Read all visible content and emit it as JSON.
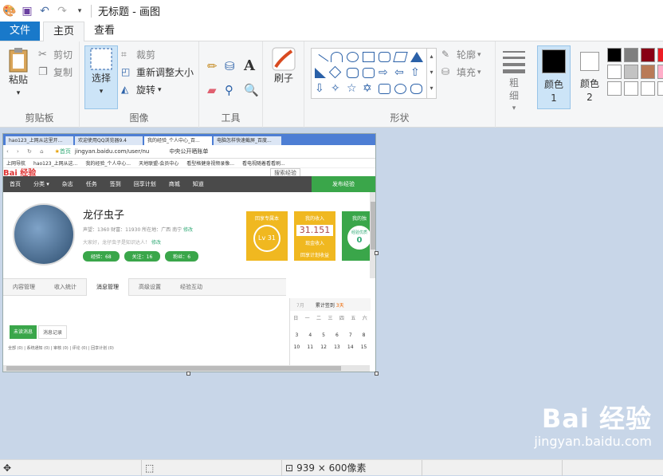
{
  "window": {
    "title": "无标题 - 画图"
  },
  "tabs": [
    {
      "label": "文件"
    },
    {
      "label": "主页"
    },
    {
      "label": "查看"
    }
  ],
  "clipboard": {
    "paste": "粘贴",
    "cut": "剪切",
    "copy": "复制",
    "group": "剪贴板"
  },
  "image": {
    "select": "选择",
    "crop": "裁剪",
    "resize": "重新调整大小",
    "rotate": "旋转",
    "group": "图像"
  },
  "tools": {
    "group": "工具"
  },
  "brushes": {
    "label": "刷子"
  },
  "shapes": {
    "outline": "轮廓",
    "fill": "填充",
    "group": "形状"
  },
  "size": {
    "label": "粗细"
  },
  "colors": {
    "color1": "颜色 1",
    "color2": "颜色 2",
    "palette": [
      "#000000",
      "#7f7f7f",
      "#880015",
      "#ed1c24",
      "#ffffff",
      "#c3c3c3",
      "#b97a57",
      "#ffaec9",
      "#ffffff",
      "#ffffff",
      "#ffffff",
      "#ffffff"
    ]
  },
  "status": {
    "dimensions": "939 × 600像素"
  },
  "browser": {
    "tabs": [
      "hao123_上网从这里开...",
      "欢迎使用QQ浏览器9.4",
      "我的经验_个人中心_百...",
      "电脑怎样快速截屏_百度..."
    ],
    "address": "jingyan.baidu.com/user/nu",
    "home_label": "首页",
    "address_extra": "中央公开晒账单",
    "bookmarks": [
      "上网导航",
      "hao123_上网从这...",
      "我的经验_个人中心...",
      "天地联盟-会员中心",
      "看型格健身视频录像...",
      "看电视随着看看刷..."
    ],
    "nav": [
      "首页",
      "分类 ▾",
      "杂志",
      "任务",
      "签到",
      "回享计划",
      "商城",
      "知道"
    ],
    "publish": "发布经验",
    "user": {
      "name": "龙仔虫子",
      "stats": "声望：1360  财富：11930  所在地：广西 南宁",
      "edit": "修改",
      "motto": "大家好，龙仔虫子是知识达人！",
      "edit2": "修改"
    },
    "pills": [
      "经验：68",
      "关注：16",
      "粉丝：6"
    ],
    "cards": {
      "level_title": "回享专属本",
      "level": "Lv 31",
      "income_title": "我的收入",
      "income": "31.151",
      "income_sub": "现金收入",
      "income_sub2": "回享计划收益",
      "quality_title": "我的独",
      "quality_sub": "经验优质",
      "quality_val": "0"
    },
    "sub_tabs": [
      "内容管理",
      "收入统计",
      "消息管理",
      "高级设置",
      "经验互动"
    ],
    "msg_tabs": [
      "未读消息",
      "消息记录"
    ],
    "msg_filter": "全部 (0)  |  系统通知 (0)  |  审核 (0)  |  评论 (0)  |  回享计划 (0)",
    "calendar": {
      "month": "7月",
      "label": "累计签到",
      "days": "3天",
      "weekdays": [
        "日",
        "一",
        "二",
        "三",
        "四",
        "五",
        "六"
      ],
      "row1": [
        "3",
        "4",
        "5",
        "6",
        "7",
        "8"
      ],
      "row2": [
        "10",
        "11",
        "12",
        "13",
        "14",
        "15"
      ]
    },
    "logo": "Bai 经验",
    "search": "搜索经验"
  },
  "watermark": {
    "logo": "Bai 经验",
    "url": "jingyan.baidu.com"
  }
}
